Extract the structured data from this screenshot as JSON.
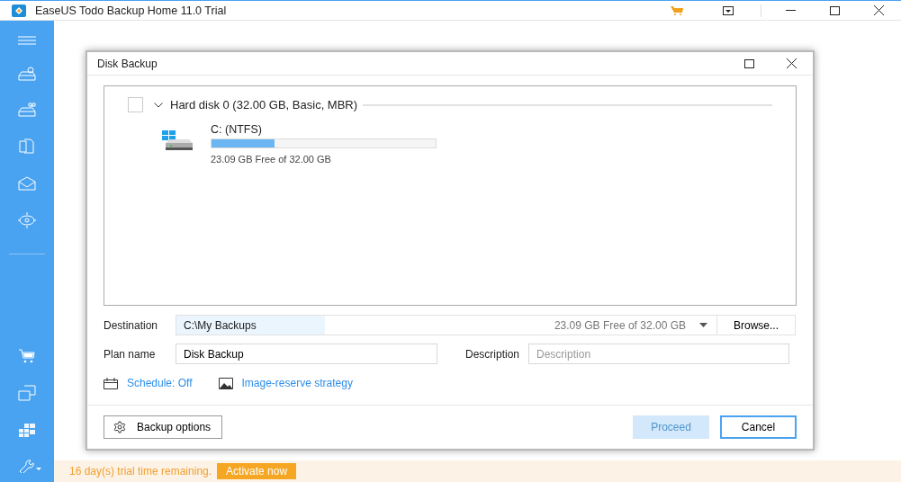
{
  "window": {
    "title": "EaseUS Todo Backup Home 11.0 Trial"
  },
  "dialog": {
    "title": "Disk Backup",
    "disk": {
      "checked": false,
      "expanded": true,
      "label": "Hard disk 0 (32.00 GB, Basic, MBR)",
      "partitions": [
        {
          "name": "C: (NTFS)",
          "level": 0.28,
          "free": "23.09 GB Free of 32.00 GB"
        }
      ]
    },
    "destination": {
      "label": "Destination",
      "value": "C:\\My Backups",
      "free": "23.09 GB Free of 32.00 GB",
      "browse": "Browse..."
    },
    "plan_name": {
      "label": "Plan name",
      "value": "Disk Backup"
    },
    "description": {
      "label": "Description",
      "placeholder": "Description"
    },
    "links": [
      {
        "kind": "schedule",
        "label": "Schedule: Off"
      },
      {
        "kind": "image",
        "label": "Image-reserve strategy"
      }
    ],
    "options_button": "Backup options",
    "buttons": [
      {
        "label": "Proceed",
        "disabled": true
      },
      {
        "label": "Cancel",
        "disabled": false
      }
    ]
  },
  "status_bar": {
    "message": "16 day(s) trial time remaining.",
    "action": "Activate now"
  }
}
